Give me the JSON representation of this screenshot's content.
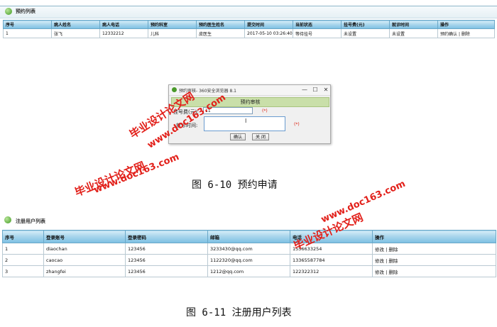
{
  "list1": {
    "title": "预约列表",
    "columns": [
      "序号",
      "病人姓名",
      "病人电话",
      "预约科室",
      "预约医生姓名",
      "提交时间",
      "当前状态",
      "挂号费(元)",
      "就诊时间",
      "操作"
    ],
    "rows": [
      {
        "no": "1",
        "name": "张飞",
        "phone": "12332212",
        "dept": "儿科",
        "doctor": "皮医生",
        "time": "2017-05-10 03:26:40",
        "status": "等待挂号",
        "fee": "未设置",
        "visit": "未设置",
        "op1": "预约确认",
        "sep": "|",
        "op2": "删除"
      }
    ]
  },
  "popup": {
    "title": "预约审核",
    "title_extra": "- 360安全浏览器 8.1",
    "min_glyph": "—",
    "max_glyph": "☐",
    "close_glyph": "✕",
    "header": "预约审核",
    "fee_label": "挂号费(元):",
    "fee_value": "11",
    "fee_required": "(*)",
    "time_label": "就诊时间:",
    "time_required": "(*)",
    "confirm_label": "确认",
    "close_label": "关 闭",
    "cursor": "I"
  },
  "caption1": "图 6-10 预约申请",
  "list2": {
    "title": "注册用户列表",
    "columns": [
      "序号",
      "登录账号",
      "登录密码",
      "邮箱",
      "电话",
      "操作"
    ],
    "rows": [
      {
        "no": "1",
        "account": "diaochan",
        "password": "123456",
        "email": "3233430@qq.com",
        "phone": "1556633254",
        "op1": "修改",
        "sep": "|",
        "op2": "删除"
      },
      {
        "no": "2",
        "account": "caocao",
        "password": "123456",
        "email": "1122320@qq.com",
        "phone": "13365587784",
        "op1": "修改",
        "sep": "|",
        "op2": "删除"
      },
      {
        "no": "3",
        "account": "zhangfei",
        "password": "123456",
        "email": "1212@qq.com",
        "phone": "122322312",
        "op1": "修改",
        "sep": "|",
        "op2": "删除"
      }
    ]
  },
  "caption2": "图 6-11 注册用户列表",
  "watermark": {
    "cn": "毕业设计论文网",
    "url": "www.doc163.com",
    "color": "#e2201a"
  }
}
